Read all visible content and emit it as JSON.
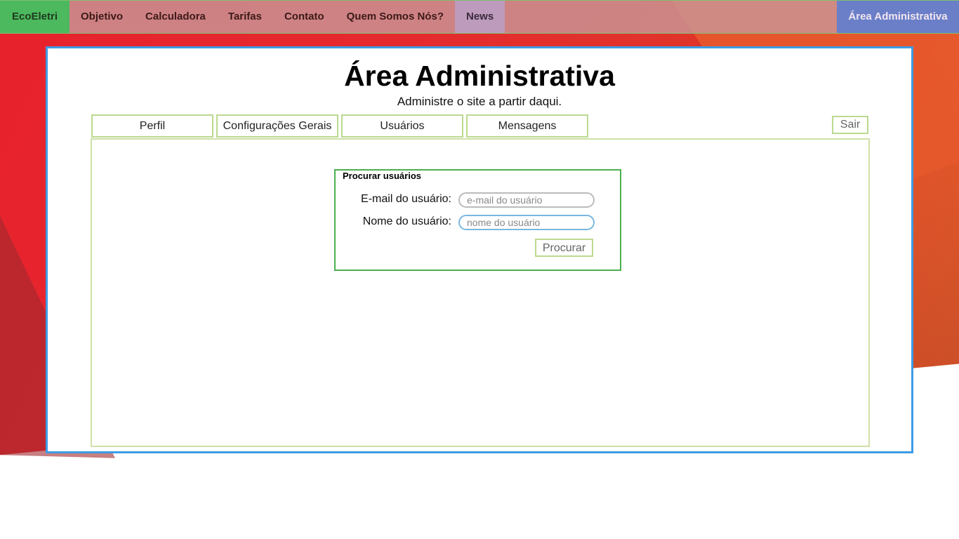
{
  "nav": {
    "brand": "EcoEletri",
    "items": [
      "Objetivo",
      "Calculadora",
      "Tarifas",
      "Contato",
      "Quem Somos Nós?",
      "News"
    ],
    "admin": "Área Administrativa"
  },
  "header": {
    "title": "Área Administrativa",
    "subtitle": "Administre o site a partir daqui."
  },
  "tabs": [
    "Perfil",
    "Configurações Gerais",
    "Usuários",
    "Mensagens"
  ],
  "logout_label": "Sair",
  "search": {
    "title": "Procurar usuários",
    "email_label": "E-mail do usuário:",
    "email_placeholder": "e-mail do usuário",
    "name_label": "Nome do usuário:",
    "name_placeholder": "nome do usuário",
    "button_label": "Procurar"
  },
  "colors": {
    "panel_border": "#3e9be4",
    "brand_bg": "#4cb95e",
    "admin_bg": "#6a7fc8",
    "search_border": "#4caf50",
    "tab_border": "#bcd98f"
  }
}
